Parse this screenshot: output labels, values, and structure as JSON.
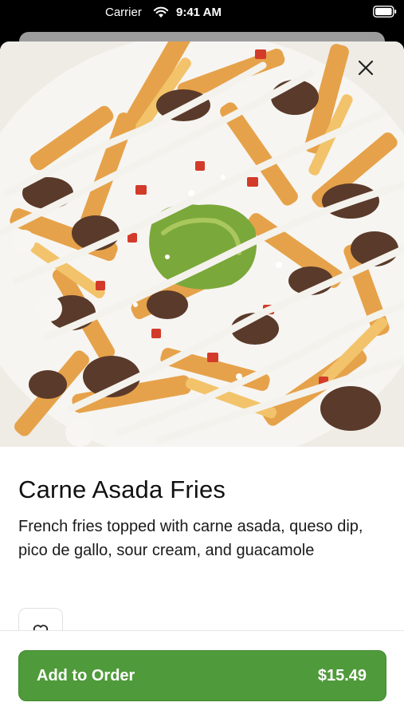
{
  "status_bar": {
    "carrier": "Carrier",
    "time": "9:41 AM"
  },
  "item": {
    "title": "Carne Asada Fries",
    "description": "French fries topped with carne asada, queso dip, pico de gallo, sour cream, and guacamole",
    "image": "carne-asada-fries-photo"
  },
  "actions": {
    "add_label": "Add to Order",
    "price": "$15.49"
  },
  "icons": {
    "close": "close-icon",
    "favorite": "heart-icon",
    "wifi": "wifi-icon",
    "battery": "battery-icon"
  },
  "colors": {
    "accent": "#4f9a3a",
    "text": "#111111"
  }
}
